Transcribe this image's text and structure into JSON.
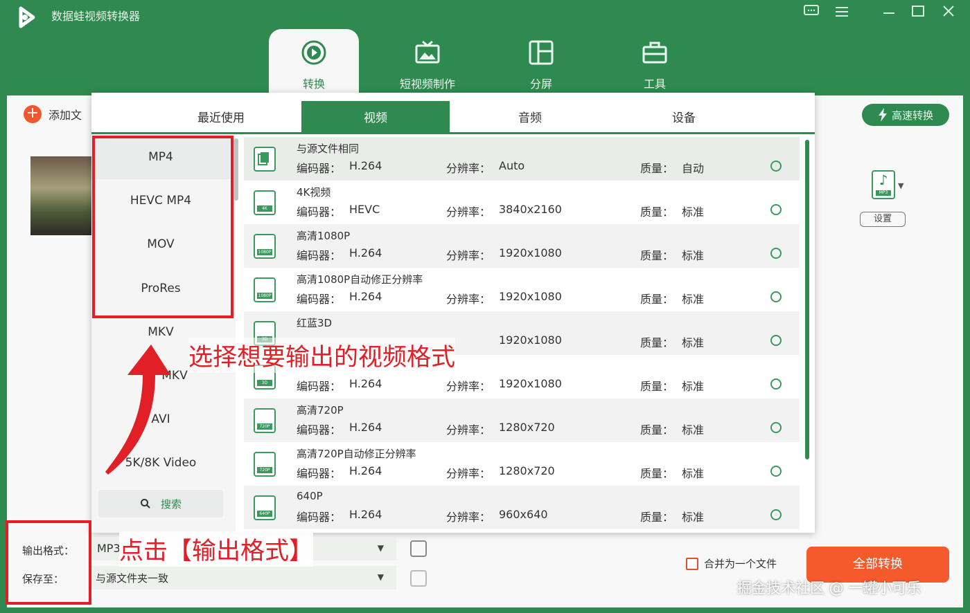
{
  "app": {
    "title": "数据蛙视频转换器"
  },
  "main_tabs": [
    {
      "label": "转换",
      "icon": "convert-icon",
      "active": true
    },
    {
      "label": "短视频制作",
      "icon": "tv-icon",
      "active": false
    },
    {
      "label": "分屏",
      "icon": "split-screen-icon",
      "active": false
    },
    {
      "label": "工具",
      "icon": "toolbox-icon",
      "active": false
    }
  ],
  "toolbar": {
    "add_file_label": "添加文",
    "fast_convert_label": "高速转换"
  },
  "output_format_icon": {
    "label": "MP3",
    "settings_label": "设置"
  },
  "format_panel": {
    "tabs": [
      {
        "label": "最近使用",
        "active": false
      },
      {
        "label": "视频",
        "active": true
      },
      {
        "label": "音频",
        "active": false
      },
      {
        "label": "设备",
        "active": false
      }
    ],
    "categories": [
      {
        "label": "MP4",
        "active": true
      },
      {
        "label": "HEVC MP4",
        "active": false
      },
      {
        "label": "MOV",
        "active": false
      },
      {
        "label": "ProRes",
        "active": false
      },
      {
        "label": "MKV",
        "active": false
      },
      {
        "label": "MKV",
        "active": false
      },
      {
        "label": "AVI",
        "active": false
      },
      {
        "label": "5K/8K Video",
        "active": false
      }
    ],
    "search_label": "搜索",
    "labels": {
      "codec": "编码器：",
      "resolution": "分辨率：",
      "quality": "质量："
    },
    "presets": [
      {
        "name": "与源文件相同",
        "codec": "H.264",
        "resolution": "Auto",
        "quality": "自动",
        "tag": ""
      },
      {
        "name": "4K视频",
        "codec": "HEVC",
        "resolution": "3840x2160",
        "quality": "标准",
        "tag": "4K"
      },
      {
        "name": "高清1080P",
        "codec": "H.264",
        "resolution": "1920x1080",
        "quality": "标准",
        "tag": "1080P"
      },
      {
        "name": "高清1080P自动修正分辨率",
        "codec": "H.264",
        "resolution": "1920x1080",
        "quality": "标准",
        "tag": "1080P"
      },
      {
        "name": "红蓝3D",
        "codec": "",
        "resolution": "1920x1080",
        "quality": "标准",
        "tag": "3D"
      },
      {
        "name": "",
        "codec": "H.264",
        "resolution": "1920x1080",
        "quality": "标准",
        "tag": "3D"
      },
      {
        "name": "高清720P",
        "codec": "H.264",
        "resolution": "1280x720",
        "quality": "标准",
        "tag": "720P"
      },
      {
        "name": "高清720P自动修正分辨率",
        "codec": "H.264",
        "resolution": "1280x720",
        "quality": "标准",
        "tag": "720P"
      },
      {
        "name": "640P",
        "codec": "H.264",
        "resolution": "960x640",
        "quality": "标准",
        "tag": "640P"
      }
    ]
  },
  "bottom": {
    "output_format_label": "输出格式：",
    "output_format_value": "MP3",
    "save_to_label": "保存至：",
    "save_to_value": "与源文件夹一致",
    "merge_label": "合并为一个文件",
    "convert_all_label": "全部转换"
  },
  "annotations": {
    "callout_select": "选择想要输出的视频格式",
    "callout_click": "点击【输出格式】"
  },
  "watermark": "掘金技术社区 @ 一罐小可乐",
  "colors": {
    "brand": "#2f8a50",
    "accent": "#f55a2c",
    "annotation": "#e01f26"
  }
}
